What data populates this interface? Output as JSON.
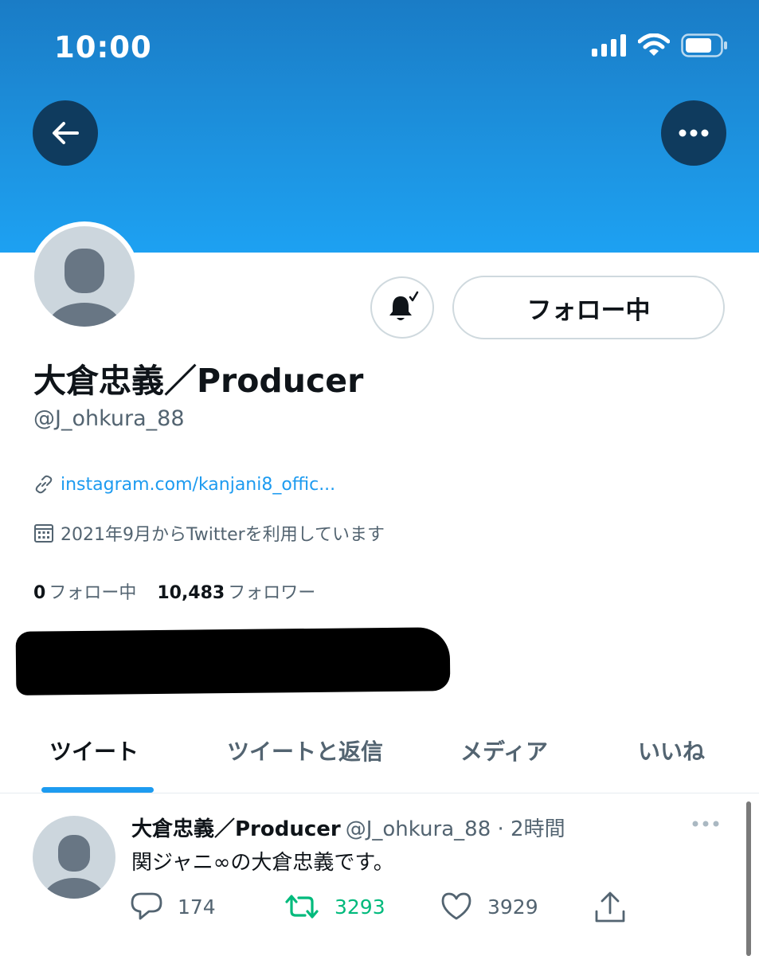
{
  "status_bar": {
    "time": "10:00"
  },
  "profile": {
    "display_name": "大倉忠義／Producer",
    "handle": "@J_ohkura_88",
    "link": "instagram.com/kanjani8_offic...",
    "joined": "2021年9月からTwitterを利用しています",
    "following_count": "0",
    "following_label": "フォロー中",
    "followers_count": "10,483",
    "followers_label": "フォロワー"
  },
  "buttons": {
    "follow_label": "フォロー中"
  },
  "tabs": [
    {
      "label": "ツイート",
      "active": true
    },
    {
      "label": "ツイートと返信",
      "active": false
    },
    {
      "label": "メディア",
      "active": false
    },
    {
      "label": "いいね",
      "active": false
    }
  ],
  "tweet": {
    "name": "大倉忠義／Producer",
    "meta": "@J_ohkura_88 · 2時間",
    "text": "関ジャニ∞の大倉忠義です。",
    "replies": "174",
    "retweets": "3293",
    "likes": "3929"
  },
  "colors": {
    "accent": "#1d9bf0",
    "retweet": "#00ba7c",
    "banner": "#1d93e0",
    "muted": "#536471"
  },
  "icons": [
    "back-arrow-icon",
    "more-icon",
    "bell-icon",
    "link-icon",
    "calendar-icon",
    "reply-icon",
    "retweet-icon",
    "like-icon",
    "share-icon"
  ]
}
